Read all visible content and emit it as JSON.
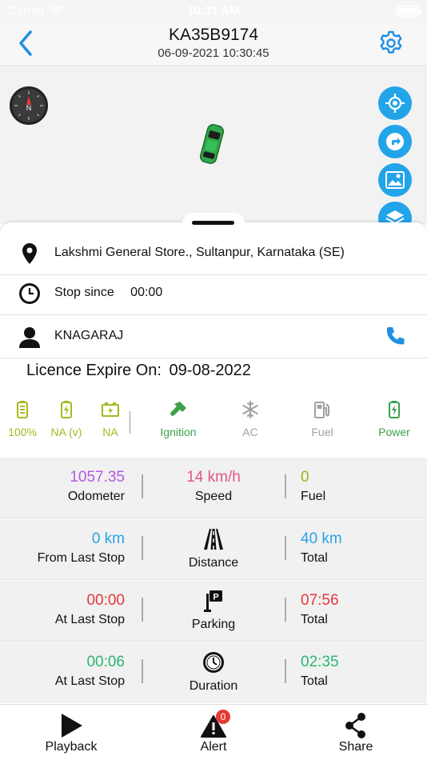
{
  "status_bar": {
    "carrier": "Carrier",
    "time": "10:31 AM"
  },
  "header": {
    "title": "KA35B9174",
    "subtitle": "06-09-2021 10:30:45"
  },
  "map": {
    "compass_label": "N"
  },
  "info": {
    "address": "Lakshmi General Store., Sultanpur, Karnataka (SE)",
    "stop_label": "Stop since",
    "stop_value": "00:00",
    "driver": "KNAGARAJ",
    "licence_label": "Licence Expire On:",
    "licence_date": "09-08-2022"
  },
  "status_strip": {
    "items": [
      {
        "label": "100%",
        "icon": "battery-icon",
        "color": "#a8b820"
      },
      {
        "label": "NA (v)",
        "icon": "battery-charge-icon",
        "color": "#a8b820"
      },
      {
        "label": "NA",
        "icon": "car-battery-icon",
        "color": "#a8b820"
      },
      {
        "label": "Ignition",
        "icon": "key-icon",
        "color": "#3aa14a"
      },
      {
        "label": "AC",
        "icon": "snowflake-icon",
        "color": "#a0a0a0"
      },
      {
        "label": "Fuel",
        "icon": "fuel-pump-icon",
        "color": "#a0a0a0"
      },
      {
        "label": "Power",
        "icon": "power-battery-icon",
        "color": "#3aa14a"
      }
    ]
  },
  "metrics": {
    "row1": {
      "left_value": "1057.35",
      "left_label": "Odometer",
      "mid_value": "14 km/h",
      "mid_label": "Speed",
      "right_value": "0",
      "right_label": "Fuel"
    },
    "row2": {
      "left_value": "0 km",
      "left_label": "From Last Stop",
      "mid_label": "Distance",
      "right_value": "40 km",
      "right_label": "Total"
    },
    "row3": {
      "left_value": "00:00",
      "left_label": "At Last Stop",
      "mid_label": "Parking",
      "right_value": "07:56",
      "right_label": "Total"
    },
    "row4": {
      "left_value": "00:06",
      "left_label": "At Last Stop",
      "mid_label": "Duration",
      "right_value": "02:35",
      "right_label": "Total"
    }
  },
  "colors": {
    "accent": "#1e8fe6",
    "odometer": "#b25ae0",
    "speed": "#e0558a",
    "fuel": "#9ab81a",
    "distance": "#29a3e6",
    "parking": "#e5383b",
    "duration": "#2bb673"
  },
  "tabbar": {
    "playback": "Playback",
    "alert": "Alert",
    "alert_badge": "0",
    "share": "Share"
  }
}
